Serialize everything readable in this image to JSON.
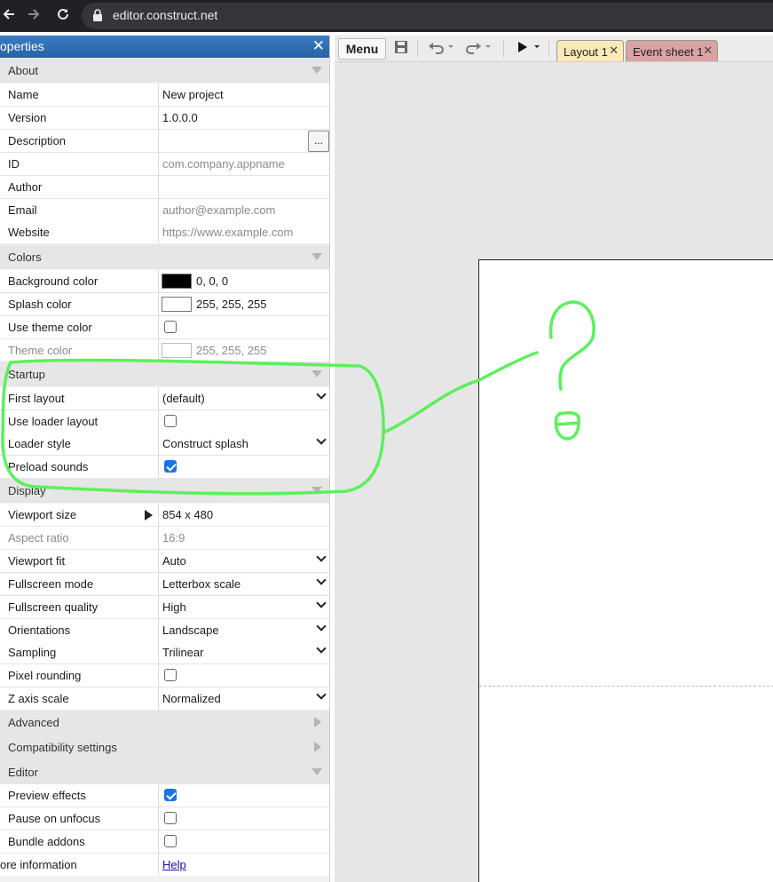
{
  "browser": {
    "url": "editor.construct.net",
    "back_icon": "back-arrow-icon",
    "forward_icon": "forward-arrow-icon",
    "reload_icon": "reload-icon",
    "lock_icon": "lock-icon"
  },
  "panel": {
    "title": "operties",
    "close_glyph": "✕"
  },
  "about": {
    "header": "About",
    "name_label": "Name",
    "name_value": "New project",
    "version_label": "Version",
    "version_value": "1.0.0.0",
    "description_label": "Description",
    "description_btn": "...",
    "id_label": "ID",
    "id_placeholder": "com.company.appname",
    "author_label": "Author",
    "email_label": "Email",
    "email_placeholder": "author@example.com",
    "website_label": "Website",
    "website_placeholder": "https://www.example.com"
  },
  "colors": {
    "header": "Colors",
    "bg_label": "Background color",
    "bg_value": "0, 0, 0",
    "bg_swatch": "#000000",
    "splash_label": "Splash color",
    "splash_value": "255, 255, 255",
    "splash_swatch": "#ffffff",
    "use_theme_label": "Use theme color",
    "use_theme_checked": false,
    "theme_label": "Theme color",
    "theme_value": "255, 255, 255",
    "theme_swatch": "#ffffff"
  },
  "startup": {
    "header": "Startup",
    "first_layout_label": "First layout",
    "first_layout_value": "(default)",
    "use_loader_label": "Use loader layout",
    "use_loader_checked": false,
    "loader_style_label": "Loader style",
    "loader_style_value": "Construct splash",
    "preload_label": "Preload sounds",
    "preload_checked": true
  },
  "display": {
    "header": "Display",
    "viewport_size_label": "Viewport size",
    "viewport_size_value": "854 x 480",
    "aspect_label": "Aspect ratio",
    "aspect_value": "16:9",
    "viewport_fit_label": "Viewport fit",
    "viewport_fit_value": "Auto",
    "fullscreen_mode_label": "Fullscreen mode",
    "fullscreen_mode_value": "Letterbox scale",
    "fullscreen_quality_label": "Fullscreen quality",
    "fullscreen_quality_value": "High",
    "orientations_label": "Orientations",
    "orientations_value": "Landscape",
    "sampling_label": "Sampling",
    "sampling_value": "Trilinear",
    "pixel_rounding_label": "Pixel rounding",
    "pixel_rounding_checked": false,
    "z_axis_label": "Z axis scale",
    "z_axis_value": "Normalized"
  },
  "advanced": {
    "header": "Advanced"
  },
  "compat": {
    "header": "Compatibility settings"
  },
  "editor_section": {
    "header": "Editor",
    "preview_label": "Preview effects",
    "preview_checked": true,
    "pause_label": "Pause on unfocus",
    "pause_checked": false,
    "bundle_label": "Bundle addons",
    "bundle_checked": false
  },
  "more_info": {
    "label": "ore information",
    "link": "Help"
  },
  "toolbar": {
    "menu_label": "Menu",
    "save_icon": "save-icon",
    "undo_icon": "undo-icon",
    "redo_icon": "redo-icon",
    "play_icon": "play-icon",
    "tabs": [
      {
        "label": "Layout 1",
        "active": true,
        "color": "#fbe9b7"
      },
      {
        "label": "Event sheet 1",
        "active": false,
        "color": "#d9a3a3"
      }
    ]
  },
  "annotation": {
    "color": "#5cf05c",
    "glyph": "?"
  }
}
